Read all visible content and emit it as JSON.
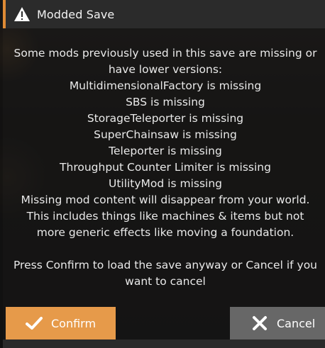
{
  "dialog": {
    "title": "Modded Save",
    "icons": {
      "title": "warning-icon",
      "confirm": "check-icon",
      "cancel": "close-icon"
    },
    "colors": {
      "accent": "#e08b35",
      "confirm_bg": "#e69a4a",
      "cancel_bg": "#676767"
    },
    "message_lines": [
      "Some mods previously used in this save are missing or",
      "have lower versions:",
      "MultidimensionalFactory is missing",
      "SBS is missing",
      "StorageTeleporter is missing",
      "SuperChainsaw is missing",
      "Teleporter is missing",
      "Throughput Counter Limiter is missing",
      "UtilityMod is missing",
      "Missing mod content will disappear from your world.",
      "This includes things like machines & items but not",
      "more generic effects like moving a foundation."
    ],
    "prompt_lines": [
      "Press Confirm to load the save anyway or Cancel if you",
      "want to cancel"
    ],
    "buttons": {
      "confirm_label": "Confirm",
      "cancel_label": "Cancel"
    }
  }
}
